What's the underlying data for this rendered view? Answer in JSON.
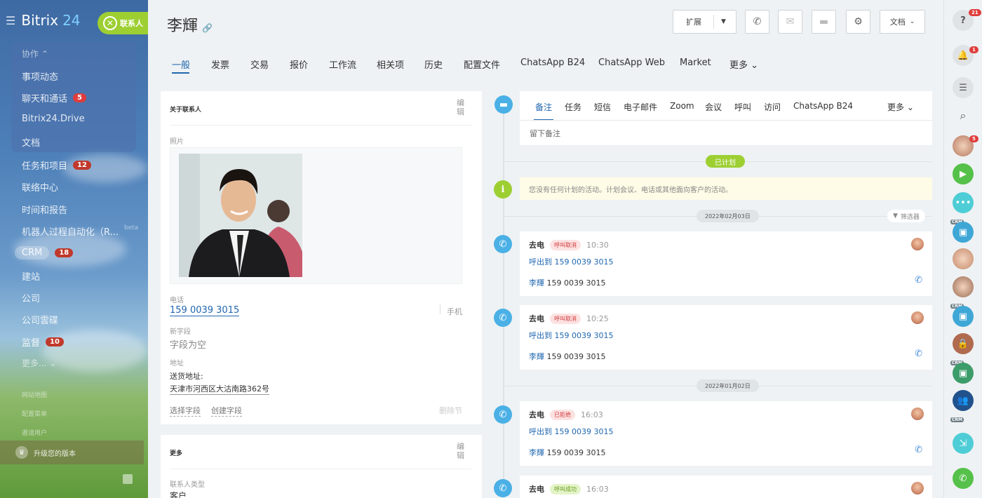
{
  "sidebar": {
    "logo_text": "Bitrix",
    "logo_num": "24",
    "contact_pill": "联系人",
    "group_head": "协作 ⌃",
    "items": [
      {
        "label": "事项动态",
        "badge": ""
      },
      {
        "label": "聊天和通话",
        "badge": "5"
      },
      {
        "label": "Bitrix24.Drive",
        "badge": ""
      },
      {
        "label": "文档",
        "badge": ""
      },
      {
        "label": "任务和项目",
        "badge": "12"
      },
      {
        "label": "联络中心",
        "badge": ""
      },
      {
        "label": "时间和报告",
        "badge": ""
      },
      {
        "label": "机器人过程自动化（R...",
        "badge": ""
      },
      {
        "label": "CRM",
        "badge": "18"
      },
      {
        "label": "建站",
        "badge": ""
      },
      {
        "label": "公司",
        "badge": ""
      },
      {
        "label": "公司雲碟",
        "badge": ""
      },
      {
        "label": "监督",
        "badge": "10"
      },
      {
        "label": "更多... ⌄",
        "badge": ""
      }
    ],
    "beta": "beta",
    "small_links": [
      "网站地图",
      "配置菜单",
      "邀请用户"
    ],
    "upgrade": "升级您的版本"
  },
  "header": {
    "title": "李輝",
    "extend": "扩展",
    "docs": "文档"
  },
  "tabs": [
    "一般",
    "发票",
    "交易",
    "报价",
    "工作流",
    "相关项",
    "历史",
    "配置文件",
    "ChatsApp B24",
    "ChatsApp Web",
    "Market",
    "更多 ⌄"
  ],
  "about": {
    "title": "关于联系人",
    "edit": "编辑",
    "photo_label": "照片",
    "phone_label": "电话",
    "phone": "159 0039 3015",
    "phone_type": "手机",
    "new_field_label": "新字段",
    "new_field_value": "字段为空",
    "address_label": "地址",
    "address_sub": "送货地址:",
    "address": "天津市河西区大沽南路362号",
    "select_field": "选择字段",
    "create_field": "创建字段",
    "delete_section": "删除节"
  },
  "more_card": {
    "title": "更多",
    "edit": "编辑",
    "type_label": "联系人类型",
    "type_value": "客户"
  },
  "editor": {
    "tabs": [
      "备注",
      "任务",
      "短信",
      "电子邮件",
      "Zoom",
      "会议",
      "呼叫",
      "访问",
      "ChatsApp B24",
      "更多 ⌄"
    ],
    "placeholder": "留下备注"
  },
  "timeline": {
    "planned": "已计划",
    "notice": "您没有任何计划的活动。计划会议、电话或其他面向客户的活动。",
    "filter": "筛选器",
    "dates": [
      "2022年02月03日",
      "2022年01月02日"
    ],
    "entries": [
      {
        "title": "去电",
        "tag": "呼叫取消",
        "tag_color": "red",
        "time": "10:30",
        "callout": "呼出到 159 0039 3015",
        "name": "李輝",
        "phone": "159 0039 3015"
      },
      {
        "title": "去电",
        "tag": "呼叫取消",
        "tag_color": "red",
        "time": "10:25",
        "callout": "呼出到 159 0039 3015",
        "name": "李輝",
        "phone": "159 0039 3015"
      },
      {
        "title": "去电",
        "tag": "已拒绝",
        "tag_color": "red",
        "time": "16:03",
        "callout": "呼出到 159 0039 3015",
        "name": "李輝",
        "phone": "159 0039 3015"
      },
      {
        "title": "去电",
        "tag": "呼叫成功",
        "tag_color": "green",
        "time": "16:03",
        "callout": "",
        "name": "",
        "phone": ""
      }
    ]
  },
  "rightbar": {
    "help_badge": "21",
    "bell_badge": "1",
    "chat_badge": "5",
    "crm_tag": "CRM"
  },
  "colors": {
    "accent": "#2067b0",
    "green": "#9dcf32",
    "timeline_blue": "#4ab0e6"
  }
}
